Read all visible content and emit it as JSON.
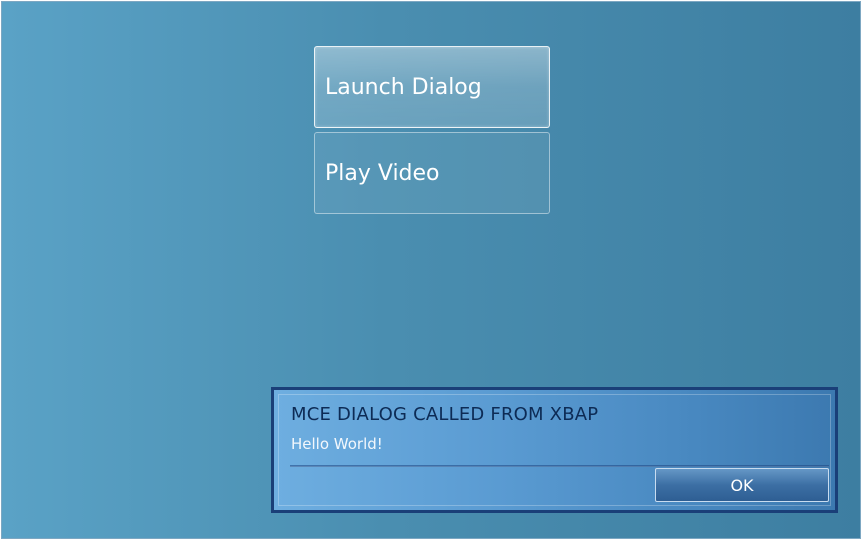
{
  "menu": {
    "launch_dialog_label": "Launch Dialog",
    "play_video_label": "Play Video"
  },
  "dialog": {
    "title": "MCE DIALOG CALLED FROM XBAP",
    "message": "Hello World!",
    "ok_label": "OK"
  },
  "colors": {
    "background_left": "#5aa2c6",
    "background_right": "#3d7ea1",
    "dialog_border": "#1a3f78",
    "dialog_title": "#0d2b55"
  }
}
